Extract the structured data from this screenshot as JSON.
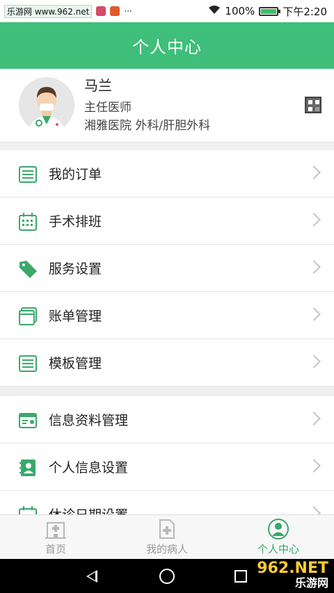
{
  "status_bar": {
    "watermark_text": "乐游网 www.962.net",
    "battery": "100%",
    "time": "下午2:20",
    "battery_level": 1.0
  },
  "header": {
    "title": "个人中心"
  },
  "profile": {
    "name": "马兰",
    "title": "主任医师",
    "org": "湘雅医院  外科/肝胆外科"
  },
  "menu": [
    {
      "label": "我的订单",
      "icon": "list-icon"
    },
    {
      "label": "手术排班",
      "icon": "calendar-icon"
    },
    {
      "label": "服务设置",
      "icon": "tag-icon"
    },
    {
      "label": "账单管理",
      "icon": "bill-icon"
    },
    {
      "label": "模板管理",
      "icon": "template-icon"
    },
    {
      "label": "信息资料管理",
      "icon": "id-card-icon"
    },
    {
      "label": "个人信息设置",
      "icon": "contacts-icon"
    },
    {
      "label": "休诊日期设置",
      "icon": "calendar-icon"
    }
  ],
  "tabs": [
    {
      "label": "首页",
      "icon": "hospital-icon",
      "active": false
    },
    {
      "label": "我的病人",
      "icon": "patient-file-icon",
      "active": false
    },
    {
      "label": "个人中心",
      "icon": "person-icon",
      "active": true
    }
  ],
  "watermark": {
    "line1": "962.NET",
    "line2": "乐游网"
  },
  "colors": {
    "primary": "#3fbf7a",
    "icon_green": "#3aa86b",
    "tab_active": "#35a86a"
  }
}
